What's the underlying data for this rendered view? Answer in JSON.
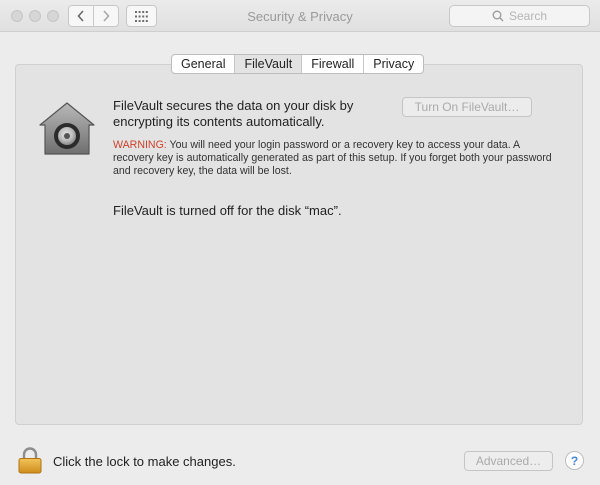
{
  "window": {
    "title": "Security & Privacy",
    "search_placeholder": "Search"
  },
  "tabs": [
    {
      "label": "General",
      "active": false
    },
    {
      "label": "FileVault",
      "active": true
    },
    {
      "label": "Firewall",
      "active": false
    },
    {
      "label": "Privacy",
      "active": false
    }
  ],
  "filevault": {
    "description": "FileVault secures the data on your disk by encrypting its contents automatically.",
    "turn_on_label": "Turn On FileVault…",
    "warning_label": "WARNING:",
    "warning_text": " You will need your login password or a recovery key to access your data. A recovery key is automatically generated as part of this setup. If you forget both your password and recovery key, the data will be lost.",
    "status": "FileVault is turned off for the disk “mac”."
  },
  "footer": {
    "lock_text": "Click the lock to make changes.",
    "advanced_label": "Advanced…",
    "help_label": "?"
  },
  "icons": [
    "back-icon",
    "forward-icon",
    "grid-icon",
    "search-icon",
    "filevault-icon",
    "lock-icon"
  ],
  "colors": {
    "warning": "#d0412b",
    "help": "#4a87d4",
    "panel": "#e3e3e3"
  }
}
